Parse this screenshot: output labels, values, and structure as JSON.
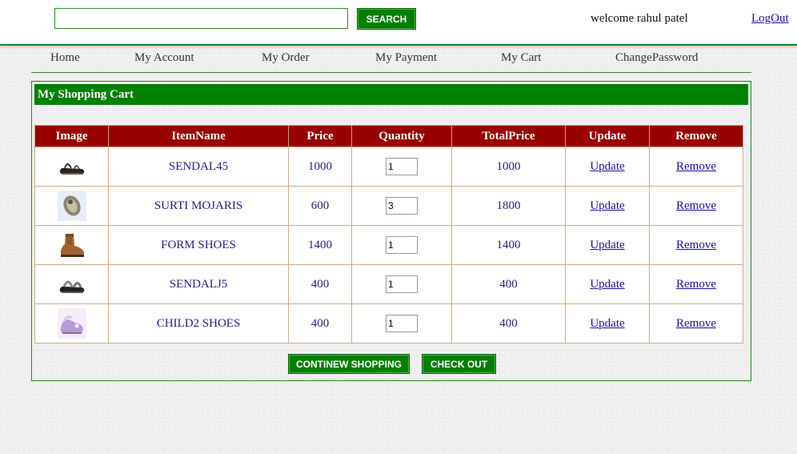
{
  "header": {
    "search_placeholder": "",
    "search_value": "",
    "search_button": "SEARCH",
    "welcome_text": "welcome rahul patel",
    "logout_label": "LogOut"
  },
  "nav": {
    "items": [
      {
        "label": "Home"
      },
      {
        "label": "My Account"
      },
      {
        "label": "My Order"
      },
      {
        "label": "My Payment"
      },
      {
        "label": "My Cart"
      },
      {
        "label": "ChangePassword"
      }
    ]
  },
  "cart": {
    "title": "My Shopping Cart",
    "columns": [
      "Image",
      "ItemName",
      "Price",
      "Quantity",
      "TotalPrice",
      "Update",
      "Remove"
    ],
    "rows": [
      {
        "image": "sandal-thumbnail",
        "name": "SENDAL45",
        "price": "1000",
        "quantity": "1",
        "total": "1000",
        "update": "Update",
        "remove": "Remove"
      },
      {
        "image": "mojari-thumbnail",
        "name": "SURTI MOJARIS",
        "price": "600",
        "quantity": "3",
        "total": "1800",
        "update": "Update",
        "remove": "Remove"
      },
      {
        "image": "boot-thumbnail",
        "name": "FORM SHOES",
        "price": "1400",
        "quantity": "1",
        "total": "1400",
        "update": "Update",
        "remove": "Remove"
      },
      {
        "image": "sandal-thumbnail",
        "name": "SENDALJ5",
        "price": "400",
        "quantity": "1",
        "total": "400",
        "update": "Update",
        "remove": "Remove"
      },
      {
        "image": "child-shoe-thumbnail",
        "name": "CHILD2 SHOES",
        "price": "400",
        "quantity": "1",
        "total": "400",
        "update": "Update",
        "remove": "Remove"
      }
    ],
    "continue_button": "CONTINEW SHOPPING",
    "checkout_button": "CHECK OUT"
  },
  "colors": {
    "brand_green": "#008000",
    "table_header": "#990000",
    "link": "#1a0dab",
    "cell_text": "#2a1a8a"
  }
}
